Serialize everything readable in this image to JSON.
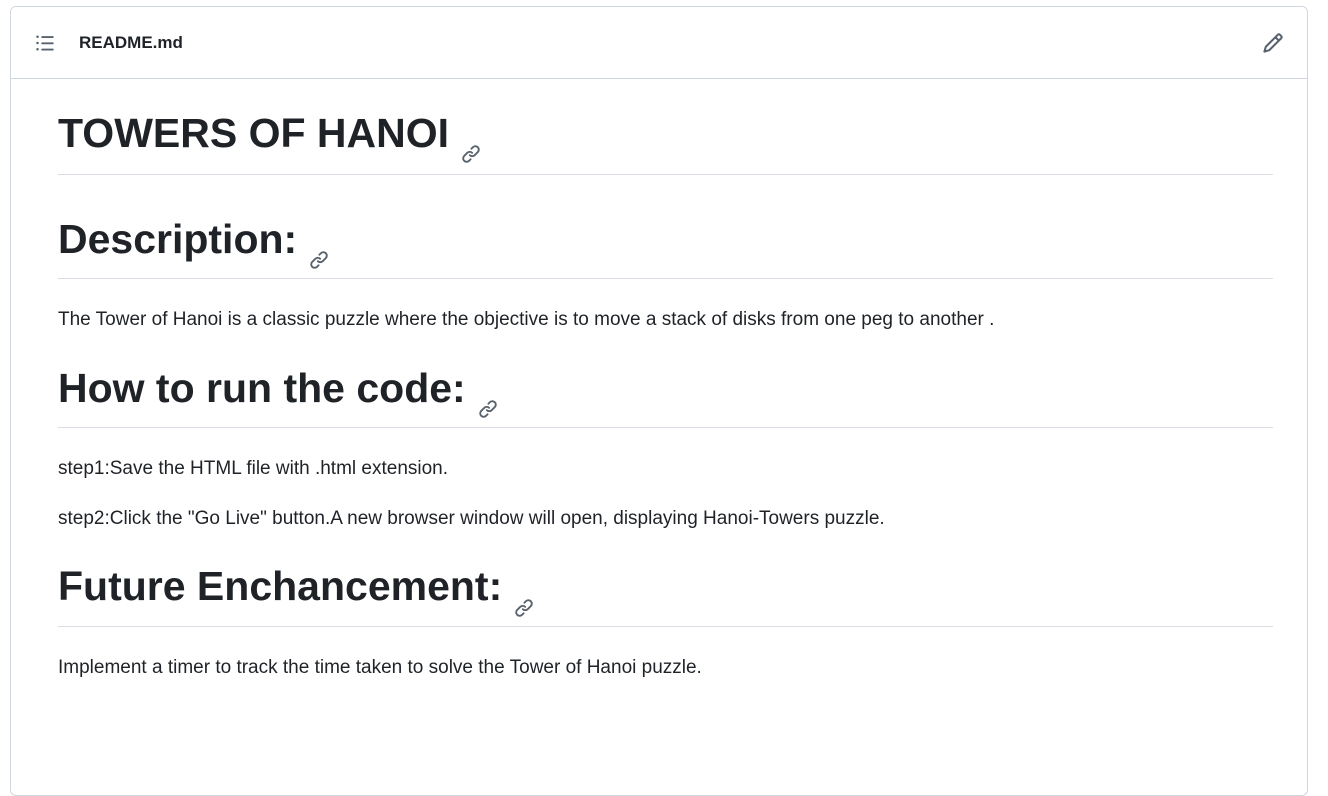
{
  "header": {
    "filename": "README.md",
    "toc_icon": "list-unordered-icon",
    "edit_icon": "pencil-icon"
  },
  "content": {
    "title": "TOWERS OF HANOI",
    "sections": [
      {
        "heading": "Description:",
        "paragraphs": [
          "The Tower of Hanoi is a classic puzzle where the objective is to move a stack of disks from one peg to another ."
        ]
      },
      {
        "heading": "How to run the code:",
        "paragraphs": [
          "step1:Save the HTML file with .html extension.",
          "step2:Click the \"Go Live\" button.A new browser window will open, displaying Hanoi-Towers puzzle."
        ]
      },
      {
        "heading": "Future Enchancement:",
        "paragraphs": [
          "Implement a timer to track the time taken to solve the Tower of Hanoi puzzle."
        ]
      }
    ]
  },
  "colors": {
    "text": "#1f2328",
    "border": "#d0d7de",
    "icon": "#59636e"
  }
}
